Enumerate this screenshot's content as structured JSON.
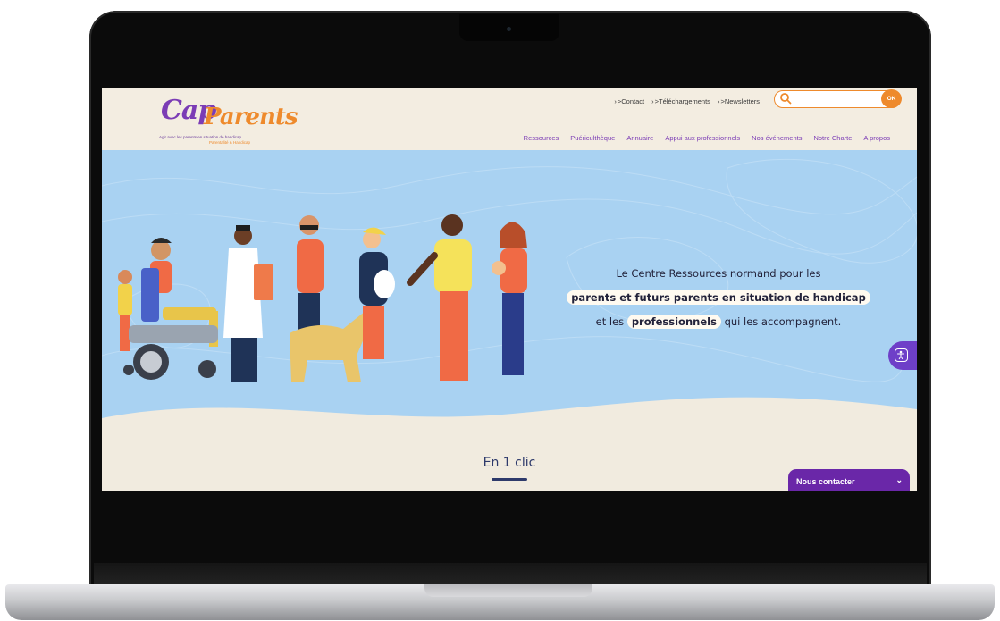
{
  "site": {
    "logo": {
      "cap": "Cap",
      "parents": "Parents",
      "tagline": "Agir avec les parents en situation de handicap",
      "region": "Parentalité & Handicap"
    },
    "top_links": [
      ">Contact",
      ">Téléchargements",
      ">Newsletters"
    ],
    "search": {
      "placeholder": "",
      "button": "OK"
    },
    "nav": [
      "Ressources",
      "Puériculthèque",
      "Annuaire",
      "Appui aux professionnels",
      "Nos événements",
      "Notre Charte",
      "A propos"
    ]
  },
  "hero": {
    "line1": "Le Centre Ressources normand pour les",
    "line2": "parents et futurs parents en situation de handicap",
    "line3_pre": "et les",
    "line3_pill": "professionnels",
    "line3_post": "qui les accompagnent."
  },
  "section": {
    "title": "En 1 clic"
  },
  "contact_widget": {
    "label": "Nous contacter",
    "chevron": "⌄"
  },
  "colors": {
    "brand_purple": "#6a27a8",
    "brand_orange": "#ee8a2c",
    "hero_blue": "#a9d2f2",
    "header_bg": "#f3ede1"
  },
  "icons": [
    "search-icon",
    "accessibility-icon",
    "chevron-down-icon"
  ]
}
